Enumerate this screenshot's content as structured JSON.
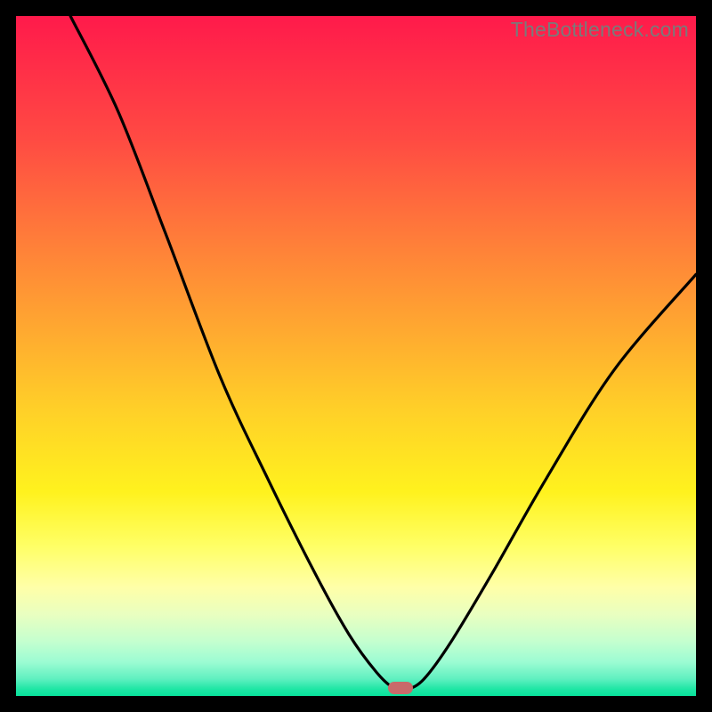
{
  "watermark": "TheBottleneck.com",
  "chart_data": {
    "type": "line",
    "title": "",
    "xlabel": "",
    "ylabel": "",
    "xlim": [
      0,
      100
    ],
    "ylim": [
      0,
      100
    ],
    "grid": false,
    "series": [
      {
        "name": "curve",
        "x": [
          8,
          15,
          22,
          30,
          37,
          44,
          49,
          53,
          55.5,
          57.5,
          60,
          64,
          70,
          78,
          88,
          100
        ],
        "values": [
          100,
          86,
          68,
          47,
          32,
          18,
          9,
          3.5,
          1.2,
          1.0,
          2.5,
          8,
          18,
          32,
          48,
          62
        ]
      }
    ],
    "marker": {
      "x": 56.5,
      "y": 1.2,
      "color": "#c96a6a"
    },
    "colors": {
      "curve": "#000000",
      "background_top": "#ff1a4b",
      "background_bottom": "#08e29c",
      "frame": "#000000"
    }
  }
}
